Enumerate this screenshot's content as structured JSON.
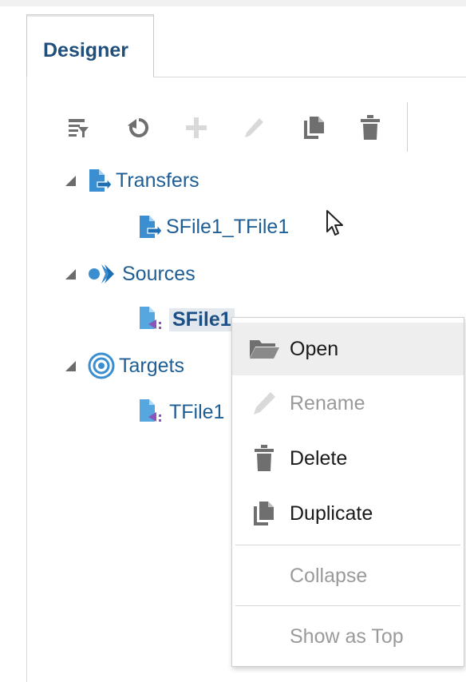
{
  "tab": {
    "label": "Designer"
  },
  "toolbar": {
    "icons": [
      "view-menu-icon",
      "refresh-icon",
      "add-icon",
      "edit-icon",
      "duplicate-icon",
      "delete-icon"
    ],
    "enabled_color": "#6f6f6f",
    "disabled_color": "#d9d9d9"
  },
  "tree": {
    "transfers": {
      "label": "Transfers",
      "children": [
        {
          "label": "SFile1_TFile1"
        }
      ]
    },
    "sources": {
      "label": "Sources",
      "children": [
        {
          "label": "SFile1",
          "selected": true
        }
      ]
    },
    "targets": {
      "label": "Targets",
      "children": [
        {
          "label": "TFile1"
        }
      ]
    }
  },
  "context_menu": {
    "items": [
      {
        "label": "Open",
        "icon": "folder-open-icon",
        "enabled": true,
        "hover": true
      },
      {
        "label": "Rename",
        "icon": "pencil-icon",
        "enabled": false
      },
      {
        "label": "Delete",
        "icon": "trash-icon",
        "enabled": true
      },
      {
        "label": "Duplicate",
        "icon": "copy-icon",
        "enabled": true
      },
      {
        "label": "Collapse",
        "enabled": false
      },
      {
        "label": "Show as Top",
        "enabled": false
      }
    ]
  },
  "colors": {
    "link_blue": "#1e5e95",
    "icon_blue": "#3b8fd1",
    "disabled": "#9a9a9a"
  }
}
